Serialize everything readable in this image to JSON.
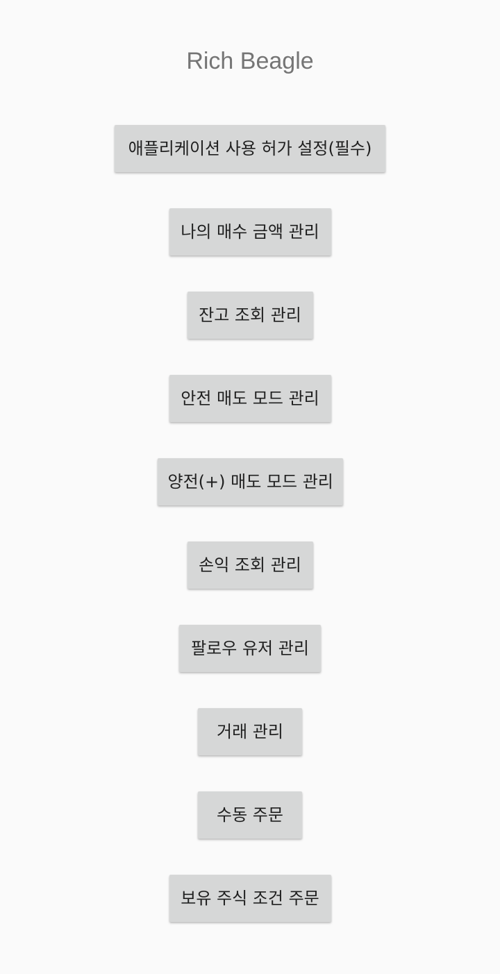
{
  "app": {
    "title": "Rich Beagle"
  },
  "menu": {
    "items": [
      {
        "id": "app-permission-settings",
        "label": "애플리케이션 사용 허가 설정(필수)"
      },
      {
        "id": "my-purchase-amount",
        "label": "나의 매수 금액 관리"
      },
      {
        "id": "balance-inquiry",
        "label": "잔고 조회 관리"
      },
      {
        "id": "safe-sell-mode",
        "label": "안전 매도 모드 관리"
      },
      {
        "id": "positive-sell-mode",
        "label": "양전(+) 매도 모드 관리"
      },
      {
        "id": "profit-loss-inquiry",
        "label": "손익 조회 관리"
      },
      {
        "id": "follow-user",
        "label": "팔로우 유저 관리"
      },
      {
        "id": "trade",
        "label": "거래 관리"
      },
      {
        "id": "manual-order",
        "label": "수동 주문"
      },
      {
        "id": "holding-stock-conditional-order",
        "label": "보유 주식 조건 주문"
      }
    ]
  }
}
